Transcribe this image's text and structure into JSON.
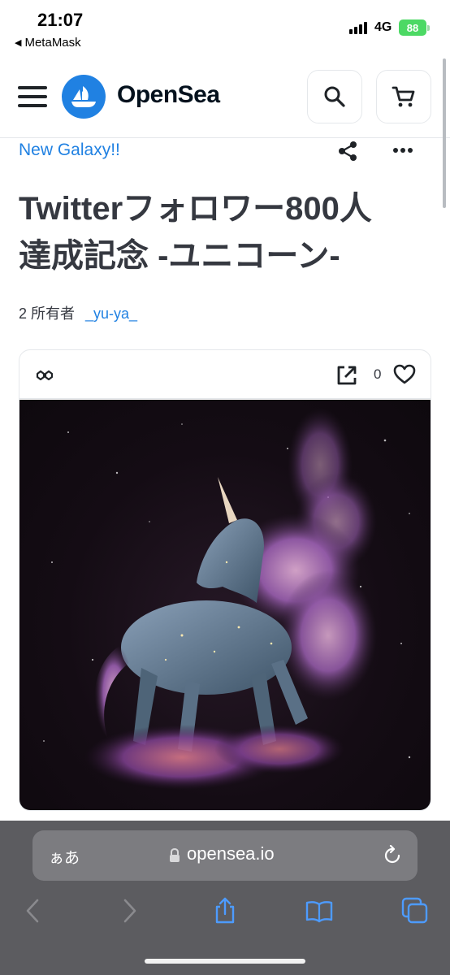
{
  "status_bar": {
    "time": "21:07",
    "back_app": "MetaMask",
    "network": "4G",
    "battery": "88"
  },
  "header": {
    "logo_text": "OpenSea",
    "icons": [
      "menu-icon",
      "opensea-logo-icon",
      "search-icon",
      "cart-icon"
    ]
  },
  "item": {
    "collection": "New Galaxy!!",
    "title_line1": "Twitterフォロワー800人",
    "title_line2": "達成記念 -ユニコーン-",
    "owners_label": "2 所有者",
    "owner_name": "_yu-ya_",
    "like_count": "0"
  },
  "browser": {
    "aa_label": "ぁあ",
    "url": "opensea.io",
    "icons": [
      "back-icon",
      "forward-icon",
      "share-icon",
      "bookmarks-icon",
      "tabs-icon"
    ]
  },
  "colors": {
    "accent": "#2081e2",
    "text": "#353840",
    "browser_bar": "#5c5c60"
  }
}
